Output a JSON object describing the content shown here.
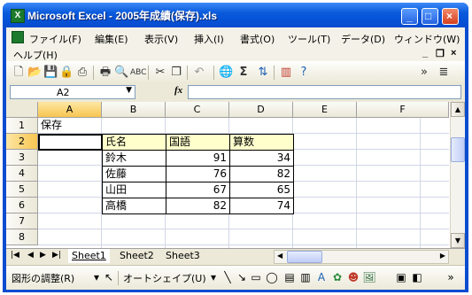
{
  "window": {
    "title": "Microsoft Excel - 2005年成績(保存).xls",
    "app_icon": "excel-icon",
    "minimize": "_",
    "maximize": "□",
    "close": "×"
  },
  "menubar": {
    "items": [
      "ファイル(F)",
      "編集(E)",
      "表示(V)",
      "挿入(I)",
      "書式(O)",
      "ツール(T)",
      "データ(D)",
      "ウィンドウ(W)",
      "ヘルプ(H)"
    ],
    "doc_min": "_",
    "doc_restore": "❐",
    "doc_close": "×"
  },
  "toolbar": {
    "icons": [
      "new-icon",
      "open-icon",
      "save-icon",
      "permission-icon",
      "print-preview-icon",
      "print-icon",
      "preview-icon",
      "spelling-icon",
      "cut-icon",
      "copy-icon",
      "undo-icon",
      "hyperlink-icon",
      "autosum-icon",
      "sort-ascending-icon",
      "chart-wizard-icon",
      "help-icon",
      "options-icon",
      "align-icon"
    ],
    "sum_glyph": "Σ"
  },
  "formula_bar": {
    "name_box": "A2",
    "fx": "fx",
    "value": ""
  },
  "sheet": {
    "columns": [
      "A",
      "B",
      "C",
      "D",
      "E",
      "F"
    ],
    "rows": [
      "1",
      "2",
      "3",
      "4",
      "5",
      "6",
      "7",
      "8"
    ],
    "a1": "保存",
    "header": {
      "name": "氏名",
      "kokugo": "国語",
      "sansu": "算数"
    },
    "students": [
      {
        "name": "鈴木",
        "kokugo": "91",
        "sansu": "34"
      },
      {
        "name": "佐藤",
        "kokugo": "76",
        "sansu": "82"
      },
      {
        "name": "山田",
        "kokugo": "67",
        "sansu": "65"
      },
      {
        "name": "高橋",
        "kokugo": "82",
        "sansu": "74"
      }
    ],
    "active_cell": "A2"
  },
  "tabs": {
    "sheets": [
      "Sheet1",
      "Sheet2",
      "Sheet3"
    ],
    "active": "Sheet1"
  },
  "drawbar": {
    "draw_menu": "図形の調整(R)",
    "autoshape_menu": "オートシェイプ(U)"
  },
  "colors": {
    "title_blue": "#0a5bdc",
    "header_fill": "#ffffcc",
    "selected_header": "#f8c651"
  }
}
